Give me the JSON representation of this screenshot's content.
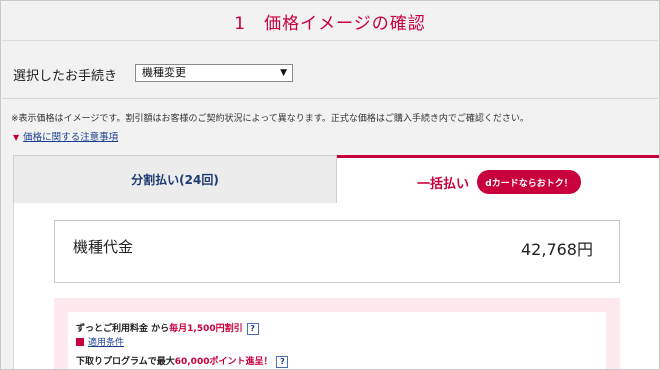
{
  "header": {
    "title": "1　価格イメージの確認"
  },
  "procedure": {
    "label": "選択したお手続き",
    "selected": "機種変更"
  },
  "note": "※表示価格はイメージです。割引額はお客様のご契約状況によって異なります。正式な価格はご購入手続き内でご確認ください。",
  "notes_link": "価格に関する注意事項",
  "tabs": {
    "installment": "分割払い(24回)",
    "lump_sum": "一括払い",
    "badge": "dカードならおトク！"
  },
  "price": {
    "label": "機種代金",
    "value": "42,768円"
  },
  "promo": {
    "line1_prefix": "ずっとご利用料金 から",
    "line1_highlight": "毎月1,500円割引",
    "condition_link": "適用条件",
    "line2_prefix": "下取りプログラムで最大",
    "line2_highlight": "60,000ポイント進呈！"
  },
  "colors": {
    "accent": "#c8003c",
    "link": "#1a3f8f"
  }
}
